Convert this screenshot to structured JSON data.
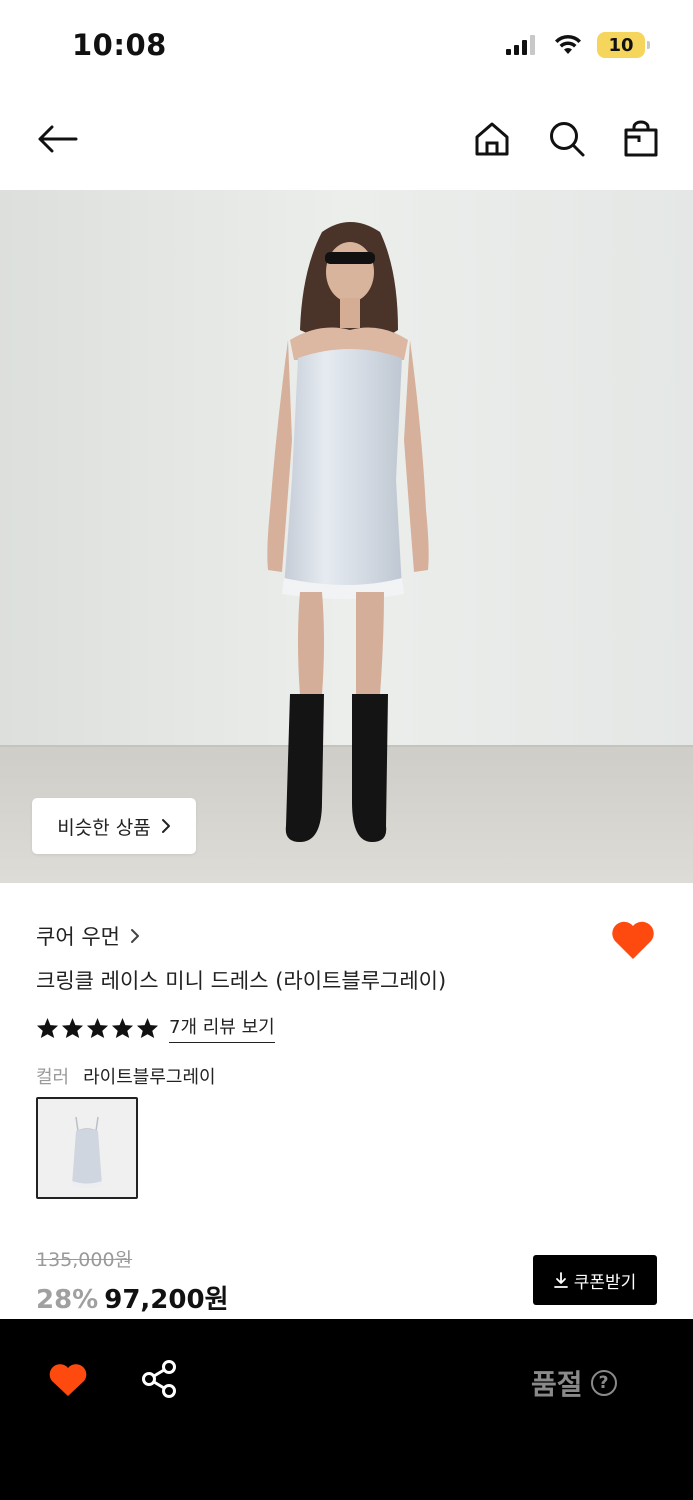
{
  "status_bar": {
    "time": "10:08",
    "battery": "10",
    "icons": [
      "signal-icon",
      "wifi-icon",
      "battery-icon"
    ]
  },
  "top_nav": {
    "icons": [
      "back-arrow-icon",
      "home-icon",
      "search-icon",
      "shopping-bag-icon"
    ]
  },
  "hero": {
    "similar_button_label": "비슷한 상품"
  },
  "product": {
    "brand": "쿠어 우먼",
    "name": "크링클 레이스 미니 드레스 (라이트블루그레이)",
    "rating_stars": 5,
    "review_link": "7개 리뷰 보기",
    "color_label": "컬러",
    "color_value": "라이트블루그레이",
    "original_price": "135,000원",
    "discount": "28%",
    "price": "97,200원",
    "coupon_button": "쿠폰받기"
  },
  "bottom_bar": {
    "status": "품절",
    "help": "?"
  },
  "colors": {
    "accent_heart": "#ff4a0f",
    "bottom_bar_bg": "#000000",
    "battery_fill": "#f6d55c"
  }
}
